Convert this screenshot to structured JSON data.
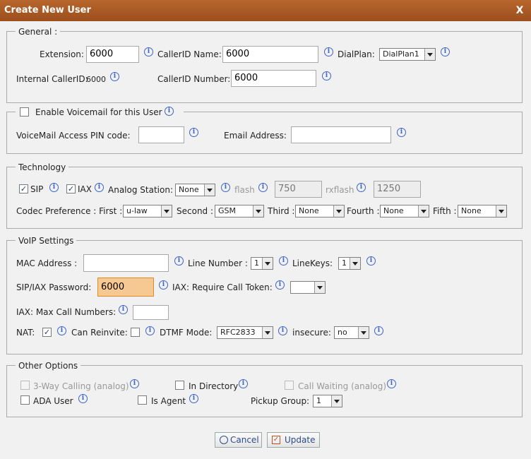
{
  "window": {
    "title": "Create New User",
    "close_label": "X"
  },
  "general": {
    "legend": "General :",
    "extension_label": "Extension:",
    "extension_value": "6000",
    "callerid_name_label": "CallerID Name:",
    "callerid_name_value": "6000",
    "dialplan_label": "DialPlan:",
    "dialplan_value": "DialPlan1",
    "internal_callerid_label": "Internal CallerID:",
    "internal_callerid_value": "6000",
    "callerid_number_label": "CallerID Number:",
    "callerid_number_value": "6000"
  },
  "voicemail": {
    "enable_label": "Enable Voicemail for this User",
    "pin_label": "VoiceMail Access PIN code:",
    "pin_value": "",
    "email_label": "Email Address:",
    "email_value": ""
  },
  "technology": {
    "legend": "Technology",
    "sip_label": "SIP",
    "iax_label": "IAX",
    "analog_label": "Analog Station:",
    "analog_value": "None",
    "flash_label": "flash",
    "flash_value": "750",
    "rxflash_label": "rxflash",
    "rxflash_value": "1250",
    "codec_label": "Codec Preference : First :",
    "codec_first": "u-law",
    "second_label": "Second :",
    "codec_second": "GSM",
    "third_label": "Third :",
    "codec_third": "None",
    "fourth_label": "Fourth :",
    "codec_fourth": "None",
    "fifth_label": "Fifth :",
    "codec_fifth": "None"
  },
  "voip": {
    "legend": "VoIP Settings",
    "mac_label": "MAC Address :",
    "mac_value": "",
    "line_number_label": "Line Number :",
    "line_number_value": "1",
    "linekeys_label": "LineKeys:",
    "linekeys_value": "1",
    "password_label": "SIP/IAX Password:",
    "password_value": "6000",
    "call_token_label": "IAX: Require Call Token:",
    "call_token_value": "",
    "max_calls_label": "IAX: Max Call Numbers:",
    "max_calls_value": "",
    "nat_label": "NAT:",
    "reinvite_label": "Can Reinvite:",
    "dtmf_label": "DTMF Mode:",
    "dtmf_value": "RFC2833",
    "insecure_label": "insecure:",
    "insecure_value": "no"
  },
  "other": {
    "legend": "Other Options",
    "three_way_label": "3-Way Calling (analog)",
    "in_directory_label": "In Directory",
    "call_waiting_label": "Call Waiting (analog)",
    "ada_label": "ADA User",
    "agent_label": "Is Agent",
    "pickup_label": "Pickup Group:",
    "pickup_value": "1"
  },
  "buttons": {
    "cancel": "Cancel",
    "update": "Update"
  },
  "colors": {
    "titlebar": "#a9561f",
    "highlight_input": "#f7c992",
    "info_icon": "#3c63c7"
  }
}
